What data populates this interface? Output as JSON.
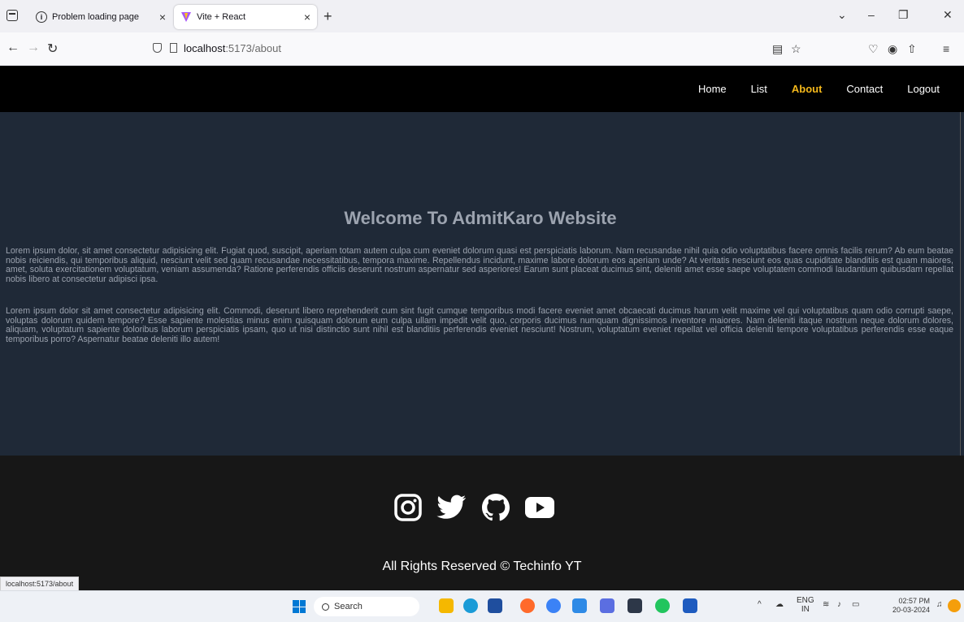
{
  "browser": {
    "tabs": [
      {
        "label": "Problem loading page",
        "active": false
      },
      {
        "label": "Vite + React",
        "active": true
      }
    ],
    "url_host": "localhost",
    "url_path": ":5173/about",
    "status_tip": "localhost:5173/about"
  },
  "site": {
    "nav": [
      {
        "label": "Home",
        "active": false
      },
      {
        "label": "List",
        "active": false
      },
      {
        "label": "About",
        "active": true
      },
      {
        "label": "Contact",
        "active": false
      },
      {
        "label": "Logout",
        "active": false
      }
    ],
    "accent_color": "#f4b81b",
    "heading": "Welcome To AdmitKaro Website",
    "paragraph1": "Lorem ipsum dolor, sit amet consectetur adipisicing elit. Fugiat quod, suscipit, aperiam totam autem culpa cum eveniet dolorum quasi est perspiciatis laborum. Nam recusandae nihil quia odio voluptatibus facere omnis facilis rerum? Ab eum beatae nobis reiciendis, qui temporibus aliquid, nesciunt velit sed quam recusandae necessitatibus, tempora maxime. Repellendus incidunt, maxime labore dolorum eos aperiam unde? At veritatis nesciunt eos quas cupiditate blanditiis est quam maiores, amet, soluta exercitationem voluptatum, veniam assumenda? Ratione perferendis officiis deserunt nostrum aspernatur sed asperiores! Earum sunt placeat ducimus sint, deleniti amet esse saepe voluptatem commodi laudantium quibusdam repellat nobis libero at consectetur adipisci ipsa.",
    "paragraph2": "Lorem ipsum dolor sit amet consectetur adipisicing elit. Commodi, deserunt libero reprehenderit cum sint fugit cumque temporibus modi facere eveniet amet obcaecati ducimus harum velit maxime vel qui voluptatibus quam odio corrupti saepe, voluptas dolorum quidem tempore? Esse sapiente molestias minus enim quisquam dolorum eum culpa ullam impedit velit quo, corporis ducimus numquam dignissimos inventore maiores. Nam deleniti itaque nostrum neque dolorum dolores, aliquam, voluptatum sapiente doloribus laborum perspiciatis ipsam, quo ut nisi distinctio sunt nihil est blanditiis perferendis eveniet nesciunt! Nostrum, voluptatum eveniet repellat vel officia deleniti tempore voluptatibus perferendis esse eaque temporibus porro? Aspernatur beatae deleniti illo autem!",
    "footer_copy": "All Rights Reserved © Techinfo YT",
    "socials": [
      "instagram-icon",
      "twitter-icon",
      "github-icon",
      "youtube-icon"
    ]
  },
  "taskbar": {
    "search_label": "Search",
    "lang_top": "ENG",
    "lang_bottom": "IN",
    "time": "02:57 PM",
    "date": "20-03-2024"
  }
}
